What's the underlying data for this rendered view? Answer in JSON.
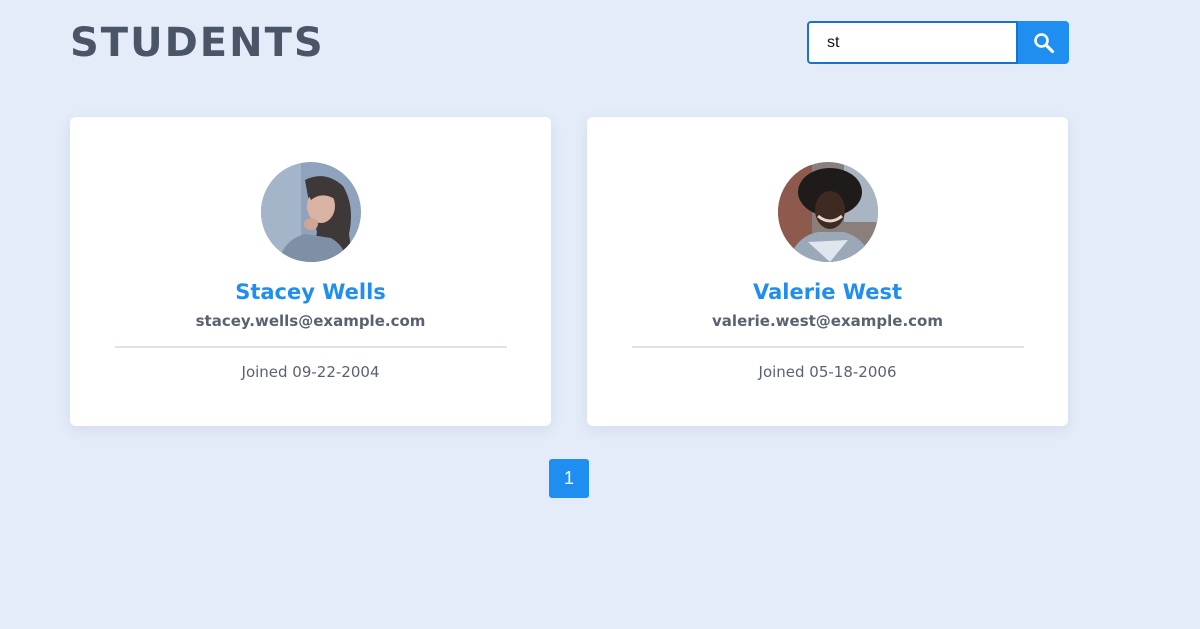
{
  "header": {
    "title": "STUDENTS"
  },
  "search": {
    "value": "st",
    "icon": "search-icon"
  },
  "students": [
    {
      "name": "Stacey Wells",
      "email": "stacey.wells@example.com",
      "joined": "Joined 09-22-2004"
    },
    {
      "name": "Valerie West",
      "email": "valerie.west@example.com",
      "joined": "Joined 05-18-2006"
    }
  ],
  "pagination": {
    "pages": [
      "1"
    ],
    "current": "1"
  },
  "colors": {
    "background": "#e4ecf9",
    "accent": "#1e8ff0",
    "title": "#4a5567",
    "text": "#5a6272"
  }
}
